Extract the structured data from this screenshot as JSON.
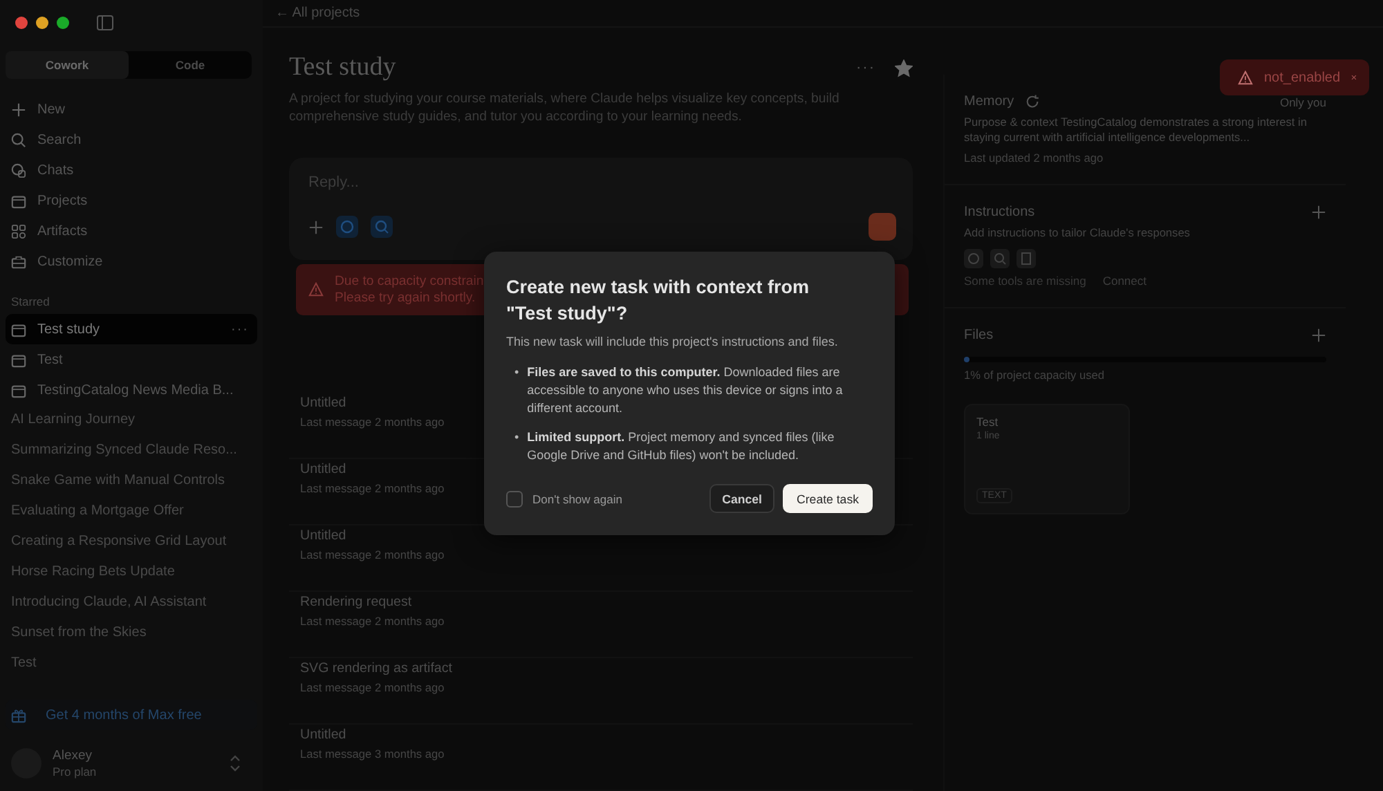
{
  "sidebar": {
    "modes": [
      {
        "label": "Cowork",
        "selected": true
      },
      {
        "label": "Code",
        "selected": false
      }
    ],
    "nav": [
      "New",
      "Search",
      "Chats",
      "Projects",
      "Artifacts",
      "Customize"
    ],
    "starred_label": "Starred",
    "starred": [
      {
        "label": "Test study",
        "selected": true,
        "more": "···"
      },
      {
        "label": "Test",
        "selected": false
      },
      {
        "label": "TestingCatalog News Media B...",
        "selected": false
      }
    ],
    "recents": [
      "AI Learning Journey",
      "Summarizing Synced Claude Reso...",
      "Snake Game with Manual Controls",
      "Evaluating a Mortgage Offer",
      "Creating a Responsive Grid Layout",
      "Horse Racing Bets Update",
      "Introducing Claude, AI Assistant",
      "Sunset from the Skies",
      "Test"
    ],
    "promo": "Get 4 months of Max free",
    "user": {
      "name": "Alexey",
      "plan": "Pro plan"
    }
  },
  "back_link": "← All projects",
  "project": {
    "title": "Test study",
    "more": "···",
    "starred": true,
    "description": "A project for studying your course materials, where Claude helps visualize key concepts, build comprehensive study guides, and tutor you according to your learning needs."
  },
  "composer": {
    "placeholder": "Reply..."
  },
  "error_banner": {
    "lines": [
      "Due to capacity constrain",
      "Please try again shortly."
    ]
  },
  "chats": [
    {
      "title": "Untitled",
      "meta": "Last message 2 months ago"
    },
    {
      "title": "Untitled",
      "meta": "Last message 2 months ago"
    },
    {
      "title": "Untitled",
      "meta": "Last message 2 months ago"
    },
    {
      "title": "Rendering request",
      "meta": "Last message 2 months ago"
    },
    {
      "title": "SVG rendering as artifact",
      "meta": "Last message 2 months ago"
    },
    {
      "title": "Untitled",
      "meta": "Last message 3 months ago"
    }
  ],
  "memory": {
    "title": "Memory",
    "visibility": "Only you",
    "text": "Purpose & context TestingCatalog demonstrates a strong interest in staying current with artificial intelligence developments...",
    "updated": "Last updated 2 months ago"
  },
  "instructions": {
    "title": "Instructions",
    "placeholder": "Add instructions to tailor Claude's responses",
    "missing": "Some tools are missing",
    "connect": "Connect"
  },
  "files": {
    "title": "Files",
    "level": 0.01,
    "capacity": "1% of project capacity used",
    "items": [
      {
        "name": "Test",
        "lines": "1 line",
        "type": "TEXT"
      }
    ]
  },
  "toast": {
    "text": "not_enabled"
  },
  "dialog": {
    "title": "Create new task with context from \"Test study\"?",
    "intro": "This new task will include this project's instructions and files.",
    "marker": "•",
    "bullets": [
      "**Files are saved to this computer.** Downloaded files are accessible to anyone who uses this device or signs into a different account.",
      "**Limited support.** Project memory and synced files (like Google Drive and GitHub files) won't be included."
    ],
    "dont_show": {
      "label": "Don't show again",
      "checked": false
    },
    "buttons": [
      "Cancel",
      "Create task"
    ]
  }
}
